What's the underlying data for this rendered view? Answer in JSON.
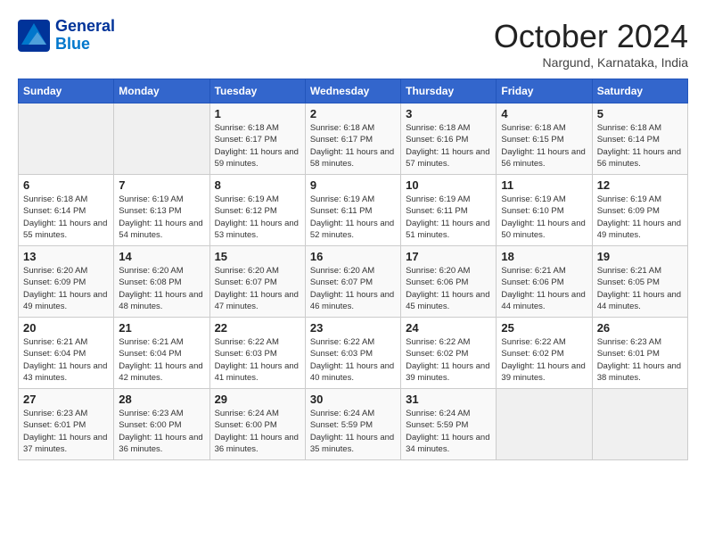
{
  "header": {
    "logo_line1": "General",
    "logo_line2": "Blue",
    "month": "October 2024",
    "location": "Nargund, Karnataka, India"
  },
  "days_of_week": [
    "Sunday",
    "Monday",
    "Tuesday",
    "Wednesday",
    "Thursday",
    "Friday",
    "Saturday"
  ],
  "weeks": [
    [
      {
        "day": "",
        "info": ""
      },
      {
        "day": "",
        "info": ""
      },
      {
        "day": "1",
        "info": "Sunrise: 6:18 AM\nSunset: 6:17 PM\nDaylight: 11 hours and 59 minutes."
      },
      {
        "day": "2",
        "info": "Sunrise: 6:18 AM\nSunset: 6:17 PM\nDaylight: 11 hours and 58 minutes."
      },
      {
        "day": "3",
        "info": "Sunrise: 6:18 AM\nSunset: 6:16 PM\nDaylight: 11 hours and 57 minutes."
      },
      {
        "day": "4",
        "info": "Sunrise: 6:18 AM\nSunset: 6:15 PM\nDaylight: 11 hours and 56 minutes."
      },
      {
        "day": "5",
        "info": "Sunrise: 6:18 AM\nSunset: 6:14 PM\nDaylight: 11 hours and 56 minutes."
      }
    ],
    [
      {
        "day": "6",
        "info": "Sunrise: 6:18 AM\nSunset: 6:14 PM\nDaylight: 11 hours and 55 minutes."
      },
      {
        "day": "7",
        "info": "Sunrise: 6:19 AM\nSunset: 6:13 PM\nDaylight: 11 hours and 54 minutes."
      },
      {
        "day": "8",
        "info": "Sunrise: 6:19 AM\nSunset: 6:12 PM\nDaylight: 11 hours and 53 minutes."
      },
      {
        "day": "9",
        "info": "Sunrise: 6:19 AM\nSunset: 6:11 PM\nDaylight: 11 hours and 52 minutes."
      },
      {
        "day": "10",
        "info": "Sunrise: 6:19 AM\nSunset: 6:11 PM\nDaylight: 11 hours and 51 minutes."
      },
      {
        "day": "11",
        "info": "Sunrise: 6:19 AM\nSunset: 6:10 PM\nDaylight: 11 hours and 50 minutes."
      },
      {
        "day": "12",
        "info": "Sunrise: 6:19 AM\nSunset: 6:09 PM\nDaylight: 11 hours and 49 minutes."
      }
    ],
    [
      {
        "day": "13",
        "info": "Sunrise: 6:20 AM\nSunset: 6:09 PM\nDaylight: 11 hours and 49 minutes."
      },
      {
        "day": "14",
        "info": "Sunrise: 6:20 AM\nSunset: 6:08 PM\nDaylight: 11 hours and 48 minutes."
      },
      {
        "day": "15",
        "info": "Sunrise: 6:20 AM\nSunset: 6:07 PM\nDaylight: 11 hours and 47 minutes."
      },
      {
        "day": "16",
        "info": "Sunrise: 6:20 AM\nSunset: 6:07 PM\nDaylight: 11 hours and 46 minutes."
      },
      {
        "day": "17",
        "info": "Sunrise: 6:20 AM\nSunset: 6:06 PM\nDaylight: 11 hours and 45 minutes."
      },
      {
        "day": "18",
        "info": "Sunrise: 6:21 AM\nSunset: 6:06 PM\nDaylight: 11 hours and 44 minutes."
      },
      {
        "day": "19",
        "info": "Sunrise: 6:21 AM\nSunset: 6:05 PM\nDaylight: 11 hours and 44 minutes."
      }
    ],
    [
      {
        "day": "20",
        "info": "Sunrise: 6:21 AM\nSunset: 6:04 PM\nDaylight: 11 hours and 43 minutes."
      },
      {
        "day": "21",
        "info": "Sunrise: 6:21 AM\nSunset: 6:04 PM\nDaylight: 11 hours and 42 minutes."
      },
      {
        "day": "22",
        "info": "Sunrise: 6:22 AM\nSunset: 6:03 PM\nDaylight: 11 hours and 41 minutes."
      },
      {
        "day": "23",
        "info": "Sunrise: 6:22 AM\nSunset: 6:03 PM\nDaylight: 11 hours and 40 minutes."
      },
      {
        "day": "24",
        "info": "Sunrise: 6:22 AM\nSunset: 6:02 PM\nDaylight: 11 hours and 39 minutes."
      },
      {
        "day": "25",
        "info": "Sunrise: 6:22 AM\nSunset: 6:02 PM\nDaylight: 11 hours and 39 minutes."
      },
      {
        "day": "26",
        "info": "Sunrise: 6:23 AM\nSunset: 6:01 PM\nDaylight: 11 hours and 38 minutes."
      }
    ],
    [
      {
        "day": "27",
        "info": "Sunrise: 6:23 AM\nSunset: 6:01 PM\nDaylight: 11 hours and 37 minutes."
      },
      {
        "day": "28",
        "info": "Sunrise: 6:23 AM\nSunset: 6:00 PM\nDaylight: 11 hours and 36 minutes."
      },
      {
        "day": "29",
        "info": "Sunrise: 6:24 AM\nSunset: 6:00 PM\nDaylight: 11 hours and 36 minutes."
      },
      {
        "day": "30",
        "info": "Sunrise: 6:24 AM\nSunset: 5:59 PM\nDaylight: 11 hours and 35 minutes."
      },
      {
        "day": "31",
        "info": "Sunrise: 6:24 AM\nSunset: 5:59 PM\nDaylight: 11 hours and 34 minutes."
      },
      {
        "day": "",
        "info": ""
      },
      {
        "day": "",
        "info": ""
      }
    ]
  ]
}
